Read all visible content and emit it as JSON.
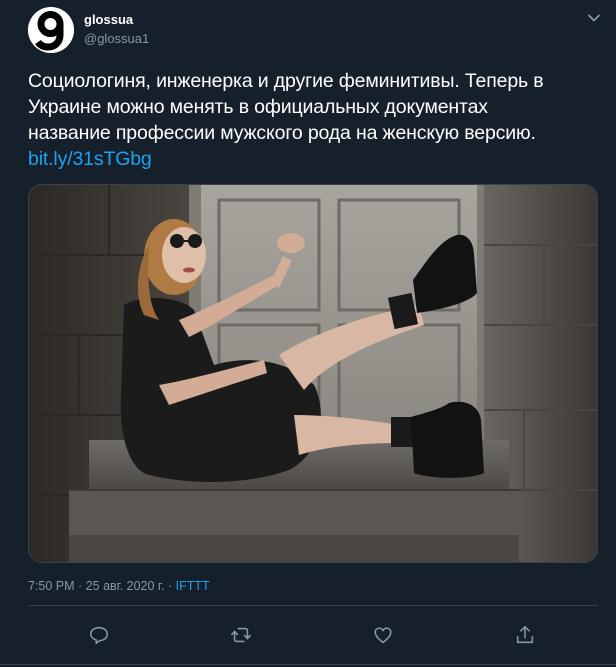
{
  "user": {
    "display_name": "glossua",
    "handle": "@glossua1",
    "avatar_icon": "glossua-logo-icon"
  },
  "tweet": {
    "text_lines": [
      "Социологиня, инженерка и другие феминитивы. Теперь в",
      "Украине можно менять в официальных документах",
      "название профессии мужского рода на женскую версию."
    ],
    "link": "bit.ly/31sTGbg"
  },
  "media": {
    "kind": "photo",
    "icon": "photo-woman-sitting-doorway"
  },
  "meta": {
    "time": "7:50 PM",
    "date": "25 авг. 2020 г.",
    "separator": "·",
    "source": "IFTTT"
  },
  "actions": {
    "reply_icon": "reply-icon",
    "retweet_icon": "retweet-icon",
    "like_icon": "heart-icon",
    "share_icon": "share-icon"
  },
  "colors": {
    "background": "#15202b",
    "text": "#ffffff",
    "secondary": "#8899a6",
    "accent": "#1da1f2",
    "border": "#38444d"
  }
}
